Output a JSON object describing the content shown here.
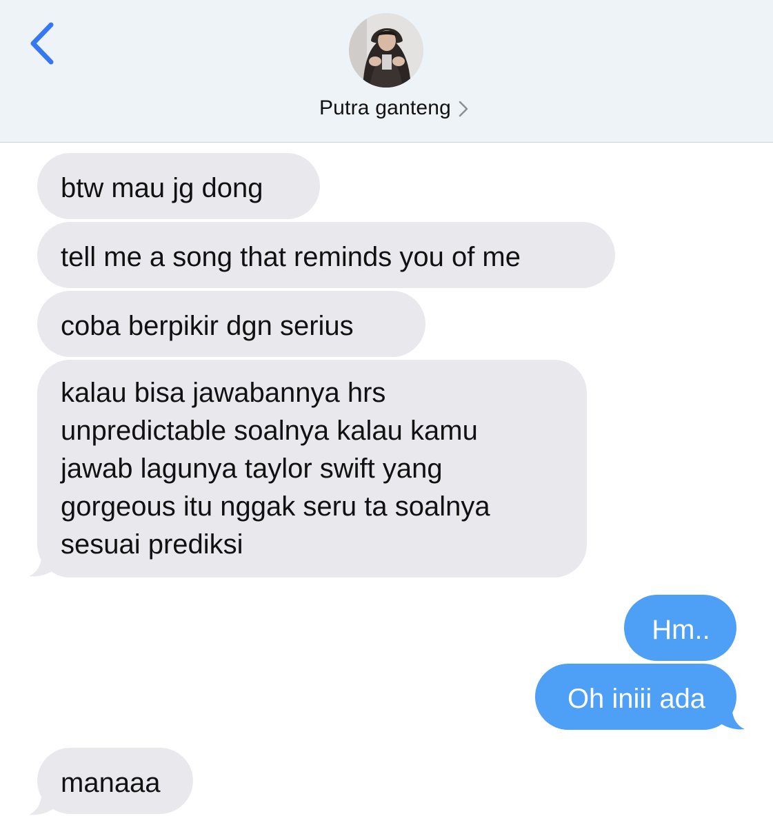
{
  "header": {
    "back_icon": "chevron-left-icon",
    "contact_name": "Putra ganteng",
    "disclosure_icon": "chevron-right-icon",
    "accent_color": "#3478f6"
  },
  "messages": [
    {
      "from": "contact",
      "text": "btw mau jg dong"
    },
    {
      "from": "contact",
      "text": "tell me a song that reminds you of me"
    },
    {
      "from": "contact",
      "text": "coba berpikir dgn serius"
    },
    {
      "from": "contact",
      "text": "kalau bisa jawabannya hrs\nunpredictable soalnya kalau kamu\njawab lagunya taylor swift yang\ngorgeous itu nggak seru ta soalnya\nsesuai prediksi"
    },
    {
      "from": "me",
      "text": "Hm.."
    },
    {
      "from": "me",
      "text": "Oh iniii ada"
    },
    {
      "from": "contact",
      "text": "manaaa"
    }
  ],
  "colors": {
    "received_bubble": "#e9e9ed",
    "sent_bubble": "#4ea0f7",
    "header_bg": "#eef3f8"
  }
}
